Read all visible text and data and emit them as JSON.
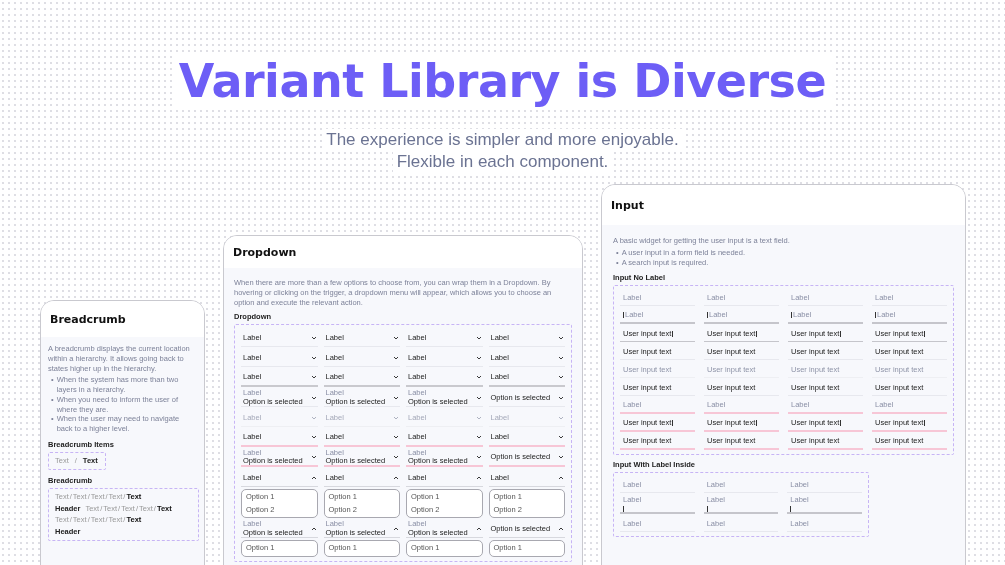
{
  "headline": "Variant Library is Diverse",
  "subtitle": [
    "The experience is simpler and more enjoyable.",
    "Flexible in each component."
  ],
  "breadcrumb_card": {
    "title": "Breadcrumb",
    "description": "A breadcrumb displays the current location within a hierarchy. It allows going back to states higher up in the hierarchy.",
    "bullet_marker": "•",
    "bullets": [
      "When the system has more than two layers in a hierarchy.",
      "When you need to inform the user of where they are.",
      "When the user may need to navigate back to a higher level."
    ],
    "items_section": {
      "title": "Breadcrumb Items",
      "items": [
        "Text",
        "Text"
      ],
      "separator": "/"
    },
    "trails_section": {
      "title": "Breadcrumb",
      "separator": "/",
      "rows": [
        {
          "items": [
            "Text",
            "Text",
            "Text",
            "Text",
            "Text"
          ]
        },
        {
          "header": "Header",
          "items": [
            "Text",
            "Text",
            "Text",
            "Text",
            "Text"
          ]
        },
        {
          "items": [
            "Text",
            "Text",
            "Text",
            "Text",
            "Text"
          ]
        },
        {
          "header": "Header"
        }
      ]
    }
  },
  "dropdown_card": {
    "title": "Dropdown",
    "description": "When there are more than a few options to choose from, you can wrap them in a Dropdown. By hovering or clicking on the trigger, a dropdown menu will appear, which allows you to choose an option and execute the relevant action.",
    "section": "Dropdown",
    "rows": [
      {
        "kind": "default",
        "cells": [
          {
            "label": "Label"
          },
          {
            "label": "Label"
          },
          {
            "label": "Label"
          },
          {
            "label": "Label"
          }
        ]
      },
      {
        "kind": "hover",
        "cells": [
          {
            "label": "Label"
          },
          {
            "label": "Label"
          },
          {
            "label": "Label"
          },
          {
            "label": "Label"
          }
        ]
      },
      {
        "kind": "active",
        "cells": [
          {
            "label": "Label"
          },
          {
            "label": "Label"
          },
          {
            "label": "Label"
          },
          {
            "label": "Label"
          }
        ]
      },
      {
        "kind": "filled",
        "cells": [
          {
            "label": "Label",
            "value": "Option is selected"
          },
          {
            "label": "Label",
            "value": "Option is selected"
          },
          {
            "label": "Label",
            "value": "Option is selected"
          },
          {
            "value": "Option is selected"
          }
        ]
      },
      {
        "kind": "disabled",
        "cells": [
          {
            "label": "Label"
          },
          {
            "label": "Label"
          },
          {
            "label": "Label"
          },
          {
            "label": "Label"
          }
        ]
      },
      {
        "kind": "error",
        "cells": [
          {
            "label": "Label"
          },
          {
            "label": "Label"
          },
          {
            "label": "Label"
          },
          {
            "label": "Label"
          }
        ]
      },
      {
        "kind": "error",
        "cells": [
          {
            "label": "Label",
            "value": "Option is selected"
          },
          {
            "label": "Label",
            "value": "Option is selected"
          },
          {
            "label": "Label",
            "value": "Option is selected"
          },
          {
            "value": "Option is selected"
          }
        ]
      },
      {
        "kind": "open",
        "cells": [
          {
            "label": "Label",
            "options": [
              "Option 1",
              "Option 2"
            ]
          },
          {
            "label": "Label",
            "options": [
              "Option 1",
              "Option 2"
            ]
          },
          {
            "label": "Label",
            "options": [
              "Option 1",
              "Option 2"
            ]
          },
          {
            "label": "Label",
            "options": [
              "Option 1",
              "Option 2"
            ]
          }
        ]
      },
      {
        "kind": "open",
        "cells": [
          {
            "label": "Label",
            "value": "Option is selected",
            "options": [
              "Option 1"
            ]
          },
          {
            "label": "Label",
            "value": "Option is selected",
            "options": [
              "Option 1"
            ]
          },
          {
            "label": "Label",
            "value": "Option is selected",
            "options": [
              "Option 1"
            ]
          },
          {
            "value": "Option is selected",
            "options": [
              "Option 1"
            ]
          }
        ]
      }
    ]
  },
  "input_card": {
    "title": "Input",
    "description": "A basic widget for getting the user input is a text field.",
    "bullet_marker": "•",
    "bullets": [
      "A user input in a form field is needed.",
      "A search input is required."
    ],
    "sections": [
      {
        "title": "Input No Label",
        "rows": [
          {
            "kind": "placeholder",
            "cells": [
              {
                "label": "Label"
              },
              {
                "label": "Label"
              },
              {
                "label": "Label"
              },
              {
                "label": "Label"
              }
            ]
          },
          {
            "kind": "focus",
            "cells": [
              {
                "label": "Label"
              },
              {
                "label": "Label"
              },
              {
                "label": "Label"
              },
              {
                "label": "Label"
              }
            ]
          },
          {
            "kind": "typing",
            "cells": [
              {
                "value": "User input text"
              },
              {
                "value": "User input text"
              },
              {
                "value": "User input text"
              },
              {
                "value": "User input text"
              }
            ]
          },
          {
            "kind": "filled",
            "cells": [
              {
                "value": "User input text"
              },
              {
                "value": "User input text"
              },
              {
                "value": "User input text"
              },
              {
                "value": "User input text"
              }
            ]
          },
          {
            "kind": "disabled",
            "cells": [
              {
                "value": "User input text"
              },
              {
                "value": "User input text"
              },
              {
                "value": "User input text"
              },
              {
                "value": "User input text"
              }
            ]
          },
          {
            "kind": "filled",
            "cells": [
              {
                "value": "User input text"
              },
              {
                "value": "User input text"
              },
              {
                "value": "User input text"
              },
              {
                "value": "User input text"
              }
            ]
          },
          {
            "kind": "error",
            "cells": [
              {
                "label": "Label"
              },
              {
                "label": "Label"
              },
              {
                "label": "Label"
              },
              {
                "label": "Label"
              }
            ]
          },
          {
            "kind": "error-typing",
            "cells": [
              {
                "value": "User input text"
              },
              {
                "value": "User input text"
              },
              {
                "value": "User input text"
              },
              {
                "value": "User input text"
              }
            ]
          },
          {
            "kind": "error",
            "cells": [
              {
                "value": "User input text"
              },
              {
                "value": "User input text"
              },
              {
                "value": "User input text"
              },
              {
                "value": "User input text"
              }
            ]
          }
        ]
      },
      {
        "title": "Input With Label Inside",
        "rows": [
          {
            "kind": "placeholder",
            "cells": [
              {
                "label": "Label"
              },
              {
                "label": "Label"
              },
              {
                "label": "Label"
              }
            ]
          },
          {
            "kind": "focus-inside",
            "cells": [
              {
                "label": "Label"
              },
              {
                "label": "Label"
              },
              {
                "label": "Label"
              }
            ]
          },
          {
            "kind": "filled",
            "cells": [
              {
                "label": "Label"
              },
              {
                "label": "Label"
              },
              {
                "label": "Label"
              }
            ]
          }
        ]
      }
    ]
  }
}
